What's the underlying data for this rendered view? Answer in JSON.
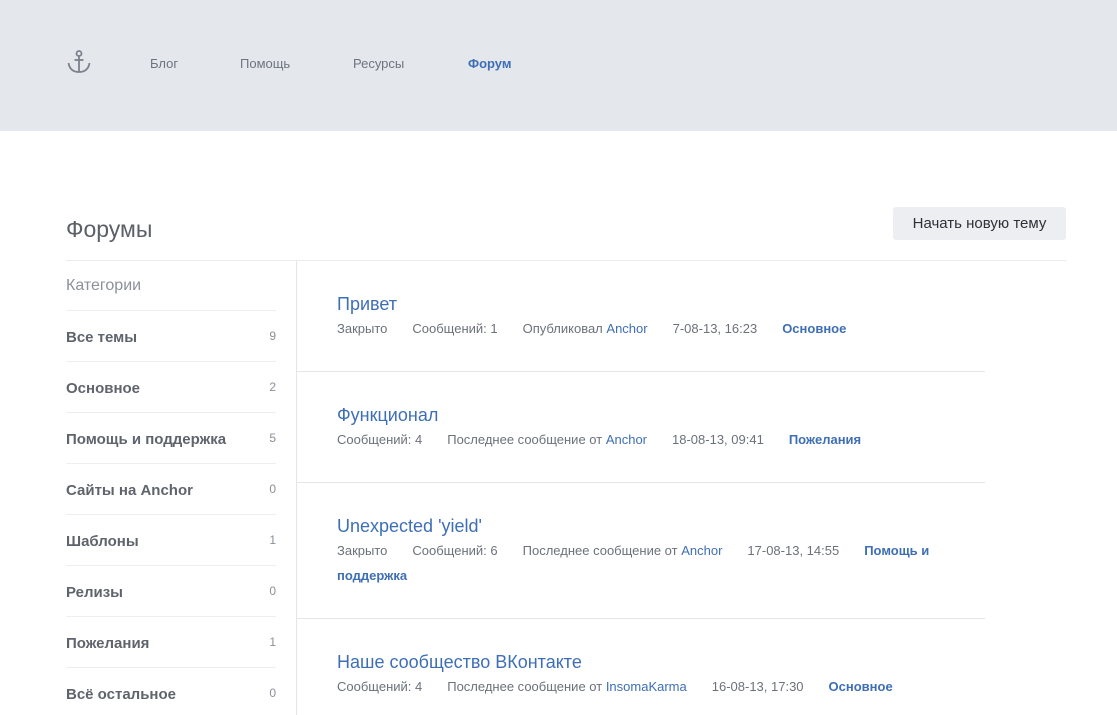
{
  "header": {
    "nav": [
      "Блог",
      "Помощь",
      "Ресурсы",
      "Форум"
    ],
    "active": "Форум"
  },
  "page_title": "Форумы",
  "new_topic_label": "Начать новую тему",
  "sidebar": {
    "heading": "Категории",
    "categories": [
      {
        "name": "Все темы",
        "count": "9"
      },
      {
        "name": "Основное",
        "count": "2"
      },
      {
        "name": "Помощь и поддержка",
        "count": "5"
      },
      {
        "name": "Сайты на Anchor",
        "count": "0"
      },
      {
        "name": "Шаблоны",
        "count": "1"
      },
      {
        "name": "Релизы",
        "count": "0"
      },
      {
        "name": "Пожелания",
        "count": "1"
      },
      {
        "name": "Всё остальное",
        "count": "0"
      }
    ]
  },
  "topics": [
    {
      "title": "Привет",
      "status": "Закрыто",
      "messages": "Сообщений: 1",
      "author_prefix": "Опубликовал",
      "author": "Anchor",
      "date": "7-08-13, 16:23",
      "category": "Основное"
    },
    {
      "title": "Функционал",
      "messages": "Сообщений: 4",
      "author_prefix": "Последнее сообщение от",
      "author": "Anchor",
      "date": "18-08-13, 09:41",
      "category": "Пожелания"
    },
    {
      "title": "Unexpected 'yield'",
      "status": "Закрыто",
      "messages": "Сообщений: 6",
      "author_prefix": "Последнее сообщение от",
      "author": "Anchor",
      "date": "17-08-13, 14:55",
      "category": "Помощь и поддержка"
    },
    {
      "title": "Наше сообщество ВКонтакте",
      "messages": "Сообщений: 4",
      "author_prefix": "Последнее сообщение от",
      "author": "InsomaKarma",
      "date": "16-08-13, 17:30",
      "category": "Основное"
    }
  ],
  "colors": {
    "header_bg": "#e4e7ec",
    "accent": "#3e6fb5"
  }
}
